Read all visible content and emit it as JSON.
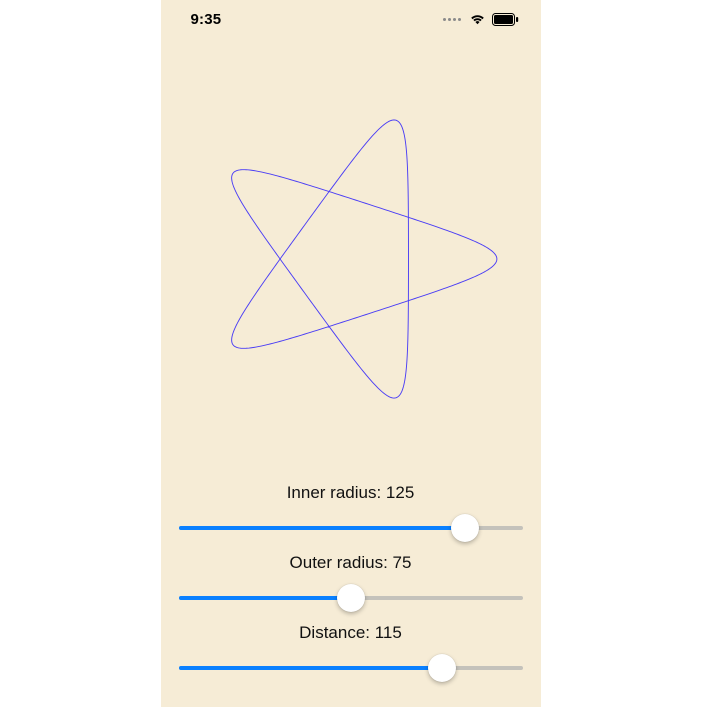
{
  "statusbar": {
    "time": "9:35"
  },
  "drawing": {
    "inner_radius": 125,
    "outer_radius": 75,
    "distance": 115,
    "stroke": "#4a3df5"
  },
  "controls": {
    "inner": {
      "label_prefix": "Inner radius: ",
      "value": 125,
      "min": 0,
      "max": 150
    },
    "outer": {
      "label_prefix": "Outer radius: ",
      "value": 75,
      "min": 0,
      "max": 150
    },
    "distance": {
      "label_prefix": "Distance: ",
      "value": 115,
      "min": 0,
      "max": 150
    }
  }
}
